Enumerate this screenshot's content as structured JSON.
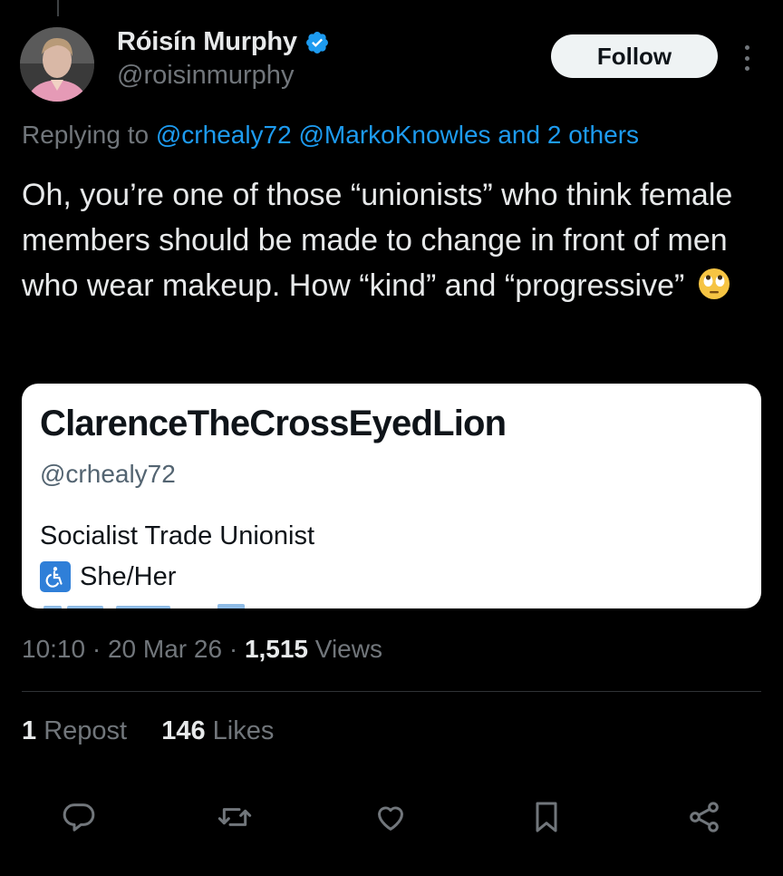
{
  "author": {
    "display_name": "Róisín Murphy",
    "handle": "@roisinmurphy",
    "verified": true
  },
  "follow_button": {
    "label": "Follow"
  },
  "reply_context": {
    "prefix": "Replying to ",
    "mentions": [
      "@crhealy72",
      "@MarkoKnowles"
    ],
    "suffix": "and 2 others"
  },
  "tweet": {
    "text": "Oh, you’re one of those “unionists” who think female members should be made to change in front of men who wear makeup. How “kind” and “progressive”",
    "emoji": "face-with-rolling-eyes"
  },
  "quote_card": {
    "name": "ClarenceTheCrossEyedLion",
    "handle": "@crhealy72",
    "bio_line1": "Socialist Trade Unionist",
    "bio_line2": "She/Her",
    "bio_icon": "wheelchair-symbol-icon"
  },
  "meta": {
    "time": "10:10",
    "sep1": " · ",
    "date": "20 Mar 26",
    "sep2": " · ",
    "views_count": "1,515",
    "views_label": " Views"
  },
  "stats": {
    "reposts_count": "1",
    "reposts_label": " Repost",
    "likes_count": "146",
    "likes_label": " Likes"
  },
  "actions": [
    "reply-icon",
    "repost-icon",
    "like-icon",
    "bookmark-icon",
    "share-icon"
  ],
  "colors": {
    "background": "#000000",
    "text": "#e7e9ea",
    "secondary": "#71767b",
    "link": "#1d9bf0",
    "verified": "#1d9bf0",
    "divider": "#2f3336"
  }
}
